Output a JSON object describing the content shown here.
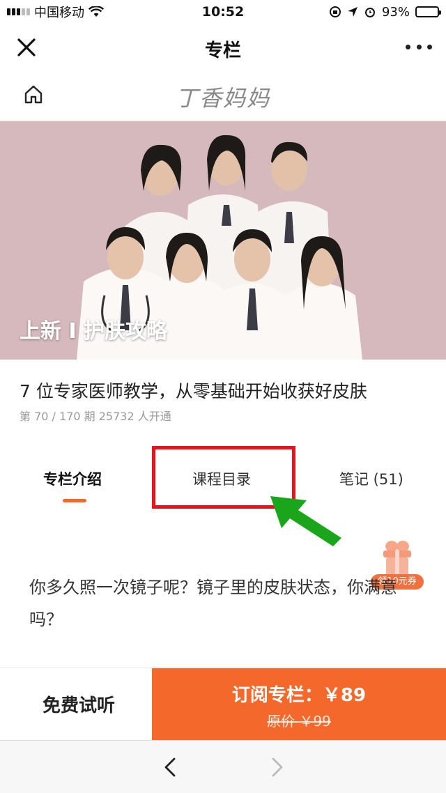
{
  "status_bar": {
    "carrier": "中国移动",
    "time": "10:52",
    "battery": "93%",
    "battery_level": 0.93
  },
  "nav": {
    "title": "专栏"
  },
  "brand": {
    "title": "丁香妈妈"
  },
  "hero": {
    "caption": "上新 I 护肤攻略"
  },
  "course": {
    "title": "7 位专家医师教学，从零基础开始收获好皮肤",
    "meta": "第 70 / 170 期   25732 人开通"
  },
  "tabs": [
    {
      "label": "专栏介绍",
      "active": true
    },
    {
      "label": "课程目录",
      "active": false
    },
    {
      "label": "笔记 (51)",
      "active": false
    }
  ],
  "coupon": {
    "label": "领10元券"
  },
  "description": {
    "text": "你多久照一次镜子呢？镜子里的皮肤状态，你满意吗？"
  },
  "actions": {
    "trial_label": "免费试听",
    "subscribe_label": "订阅专栏：￥89",
    "original_price": "原价 ￥99"
  },
  "colors": {
    "accent": "#f4682b",
    "highlight_box": "#e8141c",
    "arrow": "#1aa51a",
    "hero_background": "#d6b9bd"
  }
}
